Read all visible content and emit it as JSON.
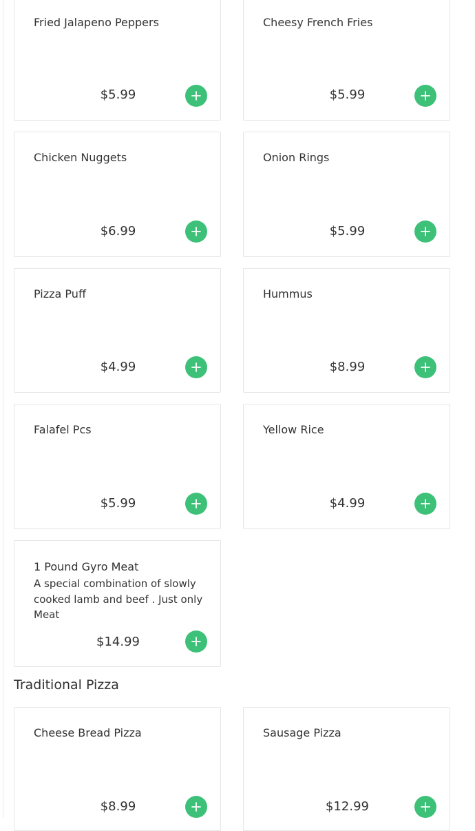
{
  "colors": {
    "accent": "#3dc178",
    "text": "#333333",
    "border": "#e5e5e5"
  },
  "items": [
    {
      "name": "Fried Jalapeno Peppers",
      "price": "$5.99"
    },
    {
      "name": "Cheesy French Fries",
      "price": "$5.99"
    },
    {
      "name": "Chicken Nuggets",
      "price": "$6.99"
    },
    {
      "name": "Onion Rings",
      "price": "$5.99"
    },
    {
      "name": "Pizza Puff",
      "price": "$4.99"
    },
    {
      "name": "Hummus",
      "price": "$8.99"
    },
    {
      "name": "Falafel Pcs",
      "price": "$5.99"
    },
    {
      "name": "Yellow Rice",
      "price": "$4.99"
    },
    {
      "name": "1 Pound Gyro Meat",
      "description": "A special combination of slowly cooked lamb and beef . Just only Meat",
      "price": "$14.99"
    }
  ],
  "sections": {
    "traditional_pizza": {
      "title": "Traditional Pizza",
      "items": [
        {
          "name": "Cheese Bread Pizza",
          "price": "$8.99"
        },
        {
          "name": "Sausage Pizza",
          "price": "$12.99"
        }
      ]
    }
  },
  "icons": {
    "add": "plus-icon"
  }
}
